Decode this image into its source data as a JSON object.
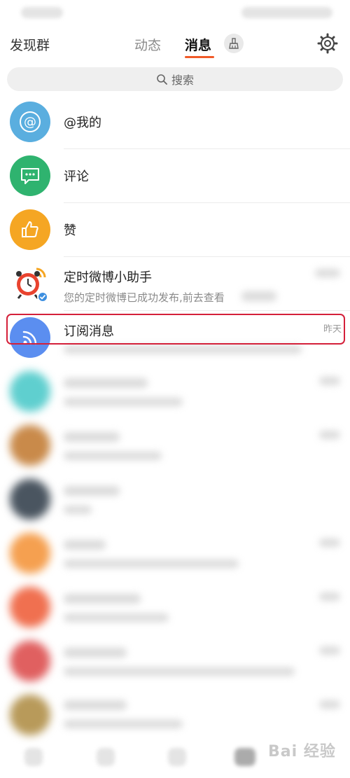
{
  "header": {
    "left_label": "发现群",
    "tabs": [
      {
        "label": "动态",
        "active": false
      },
      {
        "label": "消息",
        "active": true
      }
    ]
  },
  "search": {
    "placeholder": "搜索"
  },
  "messages": [
    {
      "title": "@我的",
      "subtitle": "",
      "time": "",
      "icon": "at-icon",
      "color": "#5aaedf"
    },
    {
      "title": "评论",
      "subtitle": "",
      "time": "",
      "icon": "comment-icon",
      "color": "#2fb36f"
    },
    {
      "title": "赞",
      "subtitle": "",
      "time": "",
      "icon": "thumbs-up-icon",
      "color": "#f5a623"
    },
    {
      "title": "定时微博小助手",
      "subtitle": "您的定时微博已成功发布,前去查看",
      "time": "",
      "icon": "alarm-clock-icon",
      "color": "#e9432f"
    },
    {
      "title": "订阅消息",
      "subtitle": "",
      "time": "昨天",
      "icon": "rss-icon",
      "color": "#5b8ef0"
    }
  ],
  "accent_color": "#f05a28",
  "highlight_color": "#d4203a",
  "watermark": "Bai 经验"
}
